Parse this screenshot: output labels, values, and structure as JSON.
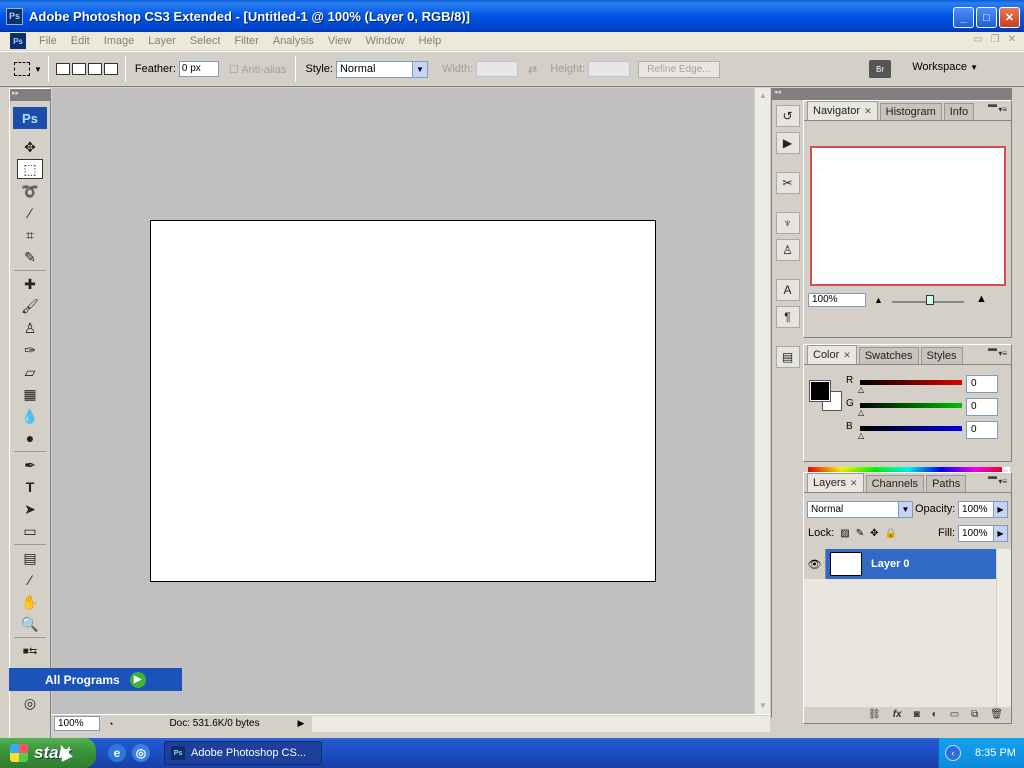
{
  "window": {
    "title": "Adobe Photoshop CS3 Extended - [Untitled-1 @ 100% (Layer 0, RGB/8)]",
    "app_icon": "Ps"
  },
  "menu": [
    "File",
    "Edit",
    "Image",
    "Layer",
    "Select",
    "Filter",
    "Analysis",
    "View",
    "Window",
    "Help"
  ],
  "options": {
    "feather_label": "Feather:",
    "feather_value": "0 px",
    "antialias_label": "Anti-alias",
    "style_label": "Style:",
    "style_value": "Normal",
    "width_label": "Width:",
    "height_label": "Height:",
    "refine_edge": "Refine Edge...",
    "workspace": "Workspace",
    "bridge_icon": "Br"
  },
  "tools": {
    "logo": "Ps",
    "items": [
      "move-icon",
      "marquee-icon",
      "lasso-icon",
      "magic-wand-icon",
      "crop-icon",
      "slice-icon",
      "healing-icon",
      "brush-icon",
      "clone-stamp-icon",
      "history-brush-icon",
      "eraser-icon",
      "gradient-icon",
      "blur-icon",
      "dodge-icon",
      "pen-icon",
      "type-icon",
      "path-select-icon",
      "shape-icon",
      "notes-icon",
      "eyedropper-icon",
      "hand-icon",
      "zoom-icon"
    ]
  },
  "status": {
    "zoom": "100%",
    "doc": "Doc: 531.6K/0 bytes"
  },
  "start_menu": {
    "all_programs": "All Programs"
  },
  "navigator": {
    "tabs": [
      "Navigator",
      "Histogram",
      "Info"
    ],
    "zoom": "100%"
  },
  "color_panel": {
    "tabs": [
      "Color",
      "Swatches",
      "Styles"
    ],
    "channels": [
      {
        "label": "R",
        "value": "0",
        "color": "#e00000"
      },
      {
        "label": "G",
        "value": "0",
        "color": "#00c000"
      },
      {
        "label": "B",
        "value": "0",
        "color": "#0000e0"
      }
    ]
  },
  "layers_panel": {
    "tabs": [
      "Layers",
      "Channels",
      "Paths"
    ],
    "blend_mode": "Normal",
    "opacity_label": "Opacity:",
    "opacity": "100%",
    "lock_label": "Lock:",
    "fill_label": "Fill:",
    "fill": "100%",
    "layer_name": "Layer 0"
  },
  "taskbar": {
    "start": "start",
    "task_title": "Adobe Photoshop CS...",
    "time": "8:35 PM"
  },
  "colors": {
    "selection": "#316ac5",
    "title_bar": "#0055e5",
    "canvas_bg": "#c0c0c0"
  }
}
